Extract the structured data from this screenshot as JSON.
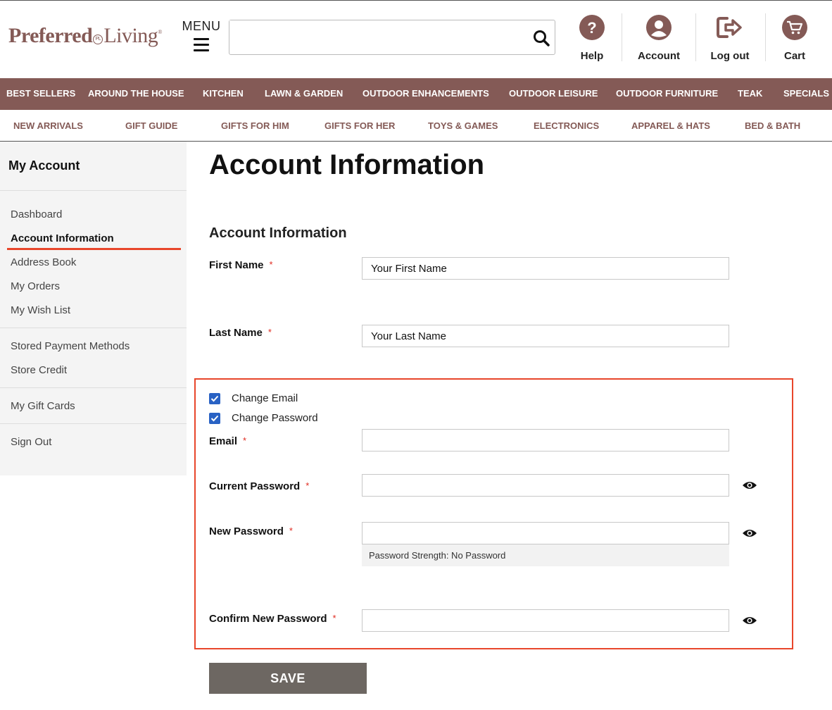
{
  "header": {
    "logo_text_bold": "Preferred",
    "logo_monogram": "PL",
    "logo_text": "Living",
    "logo_reg": "®",
    "menu_label": "MENU",
    "search_placeholder": "",
    "help_label": "Help",
    "account_label": "Account",
    "logout_label": "Log out",
    "cart_label": "Cart",
    "brand_color": "#845a56"
  },
  "nav_primary": [
    "BEST SELLERS",
    "AROUND THE HOUSE",
    "KITCHEN",
    "LAWN & GARDEN",
    "OUTDOOR ENHANCEMENTS",
    "OUTDOOR LEISURE",
    "OUTDOOR FURNITURE",
    "TEAK",
    "SPECIALS"
  ],
  "nav_secondary": [
    "NEW ARRIVALS",
    "GIFT GUIDE",
    "GIFTS FOR HIM",
    "GIFTS FOR HER",
    "TOYS & GAMES",
    "ELECTRONICS",
    "APPAREL & HATS",
    "BED & BATH"
  ],
  "sidebar": {
    "title": "My Account",
    "items": [
      "Dashboard",
      "Account Information",
      "Address Book",
      "My Orders",
      "My Wish List",
      "Stored Payment Methods",
      "Store Credit",
      "My Gift Cards",
      "Sign Out"
    ],
    "active": "Account Information"
  },
  "main": {
    "page_title": "Account Information",
    "section_title": "Account Information",
    "first_name_label": "First Name",
    "first_name_placeholder": "Your First Name",
    "last_name_label": "Last Name",
    "last_name_placeholder": "Your Last Name",
    "change_email_label": "Change Email",
    "change_password_label": "Change Password",
    "email_label": "Email",
    "current_password_label": "Current Password",
    "new_password_label": "New Password",
    "password_strength": "Password Strength: No Password",
    "confirm_password_label": "Confirm New Password",
    "required_mark": "*",
    "save_label": "SAVE",
    "highlight_color": "#e8462b",
    "checkbox_color": "#2962c4"
  }
}
